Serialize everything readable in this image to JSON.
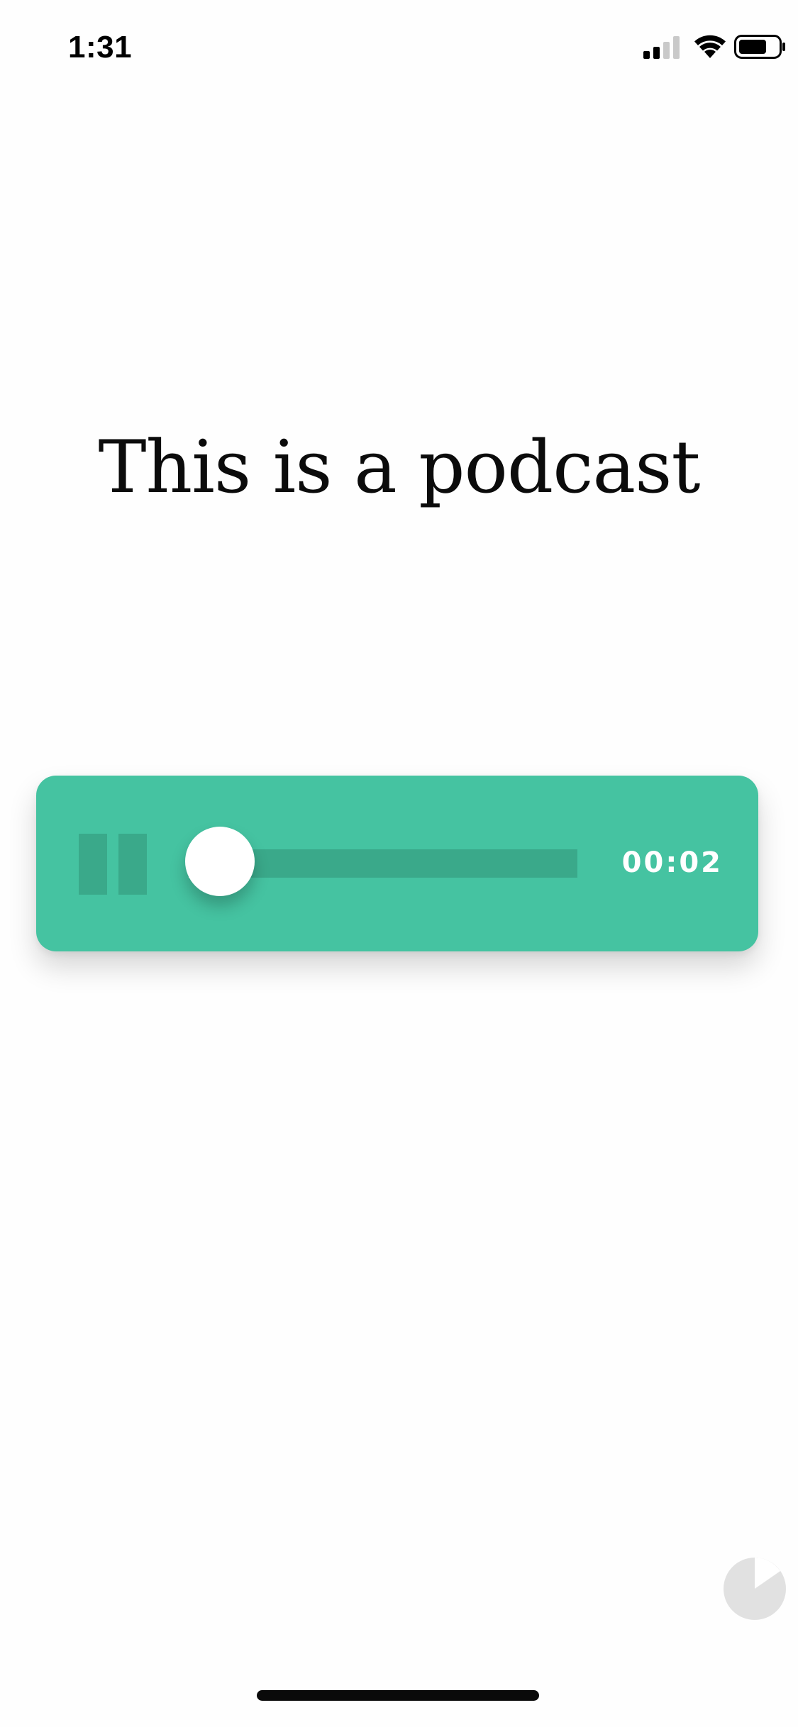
{
  "status_bar": {
    "time": "1:31",
    "icons": [
      "signal-icon",
      "wifi-icon",
      "battery-icon"
    ]
  },
  "page": {
    "title": "This is a podcast"
  },
  "player": {
    "state": "playing",
    "control_icon": "pause-icon",
    "elapsed_time": "00:02",
    "progress_fraction": 0.08,
    "accent_color": "#45c3a1",
    "track_color": "#3aa98a"
  },
  "corner_widget": {
    "icon": "pie-timer-icon"
  }
}
